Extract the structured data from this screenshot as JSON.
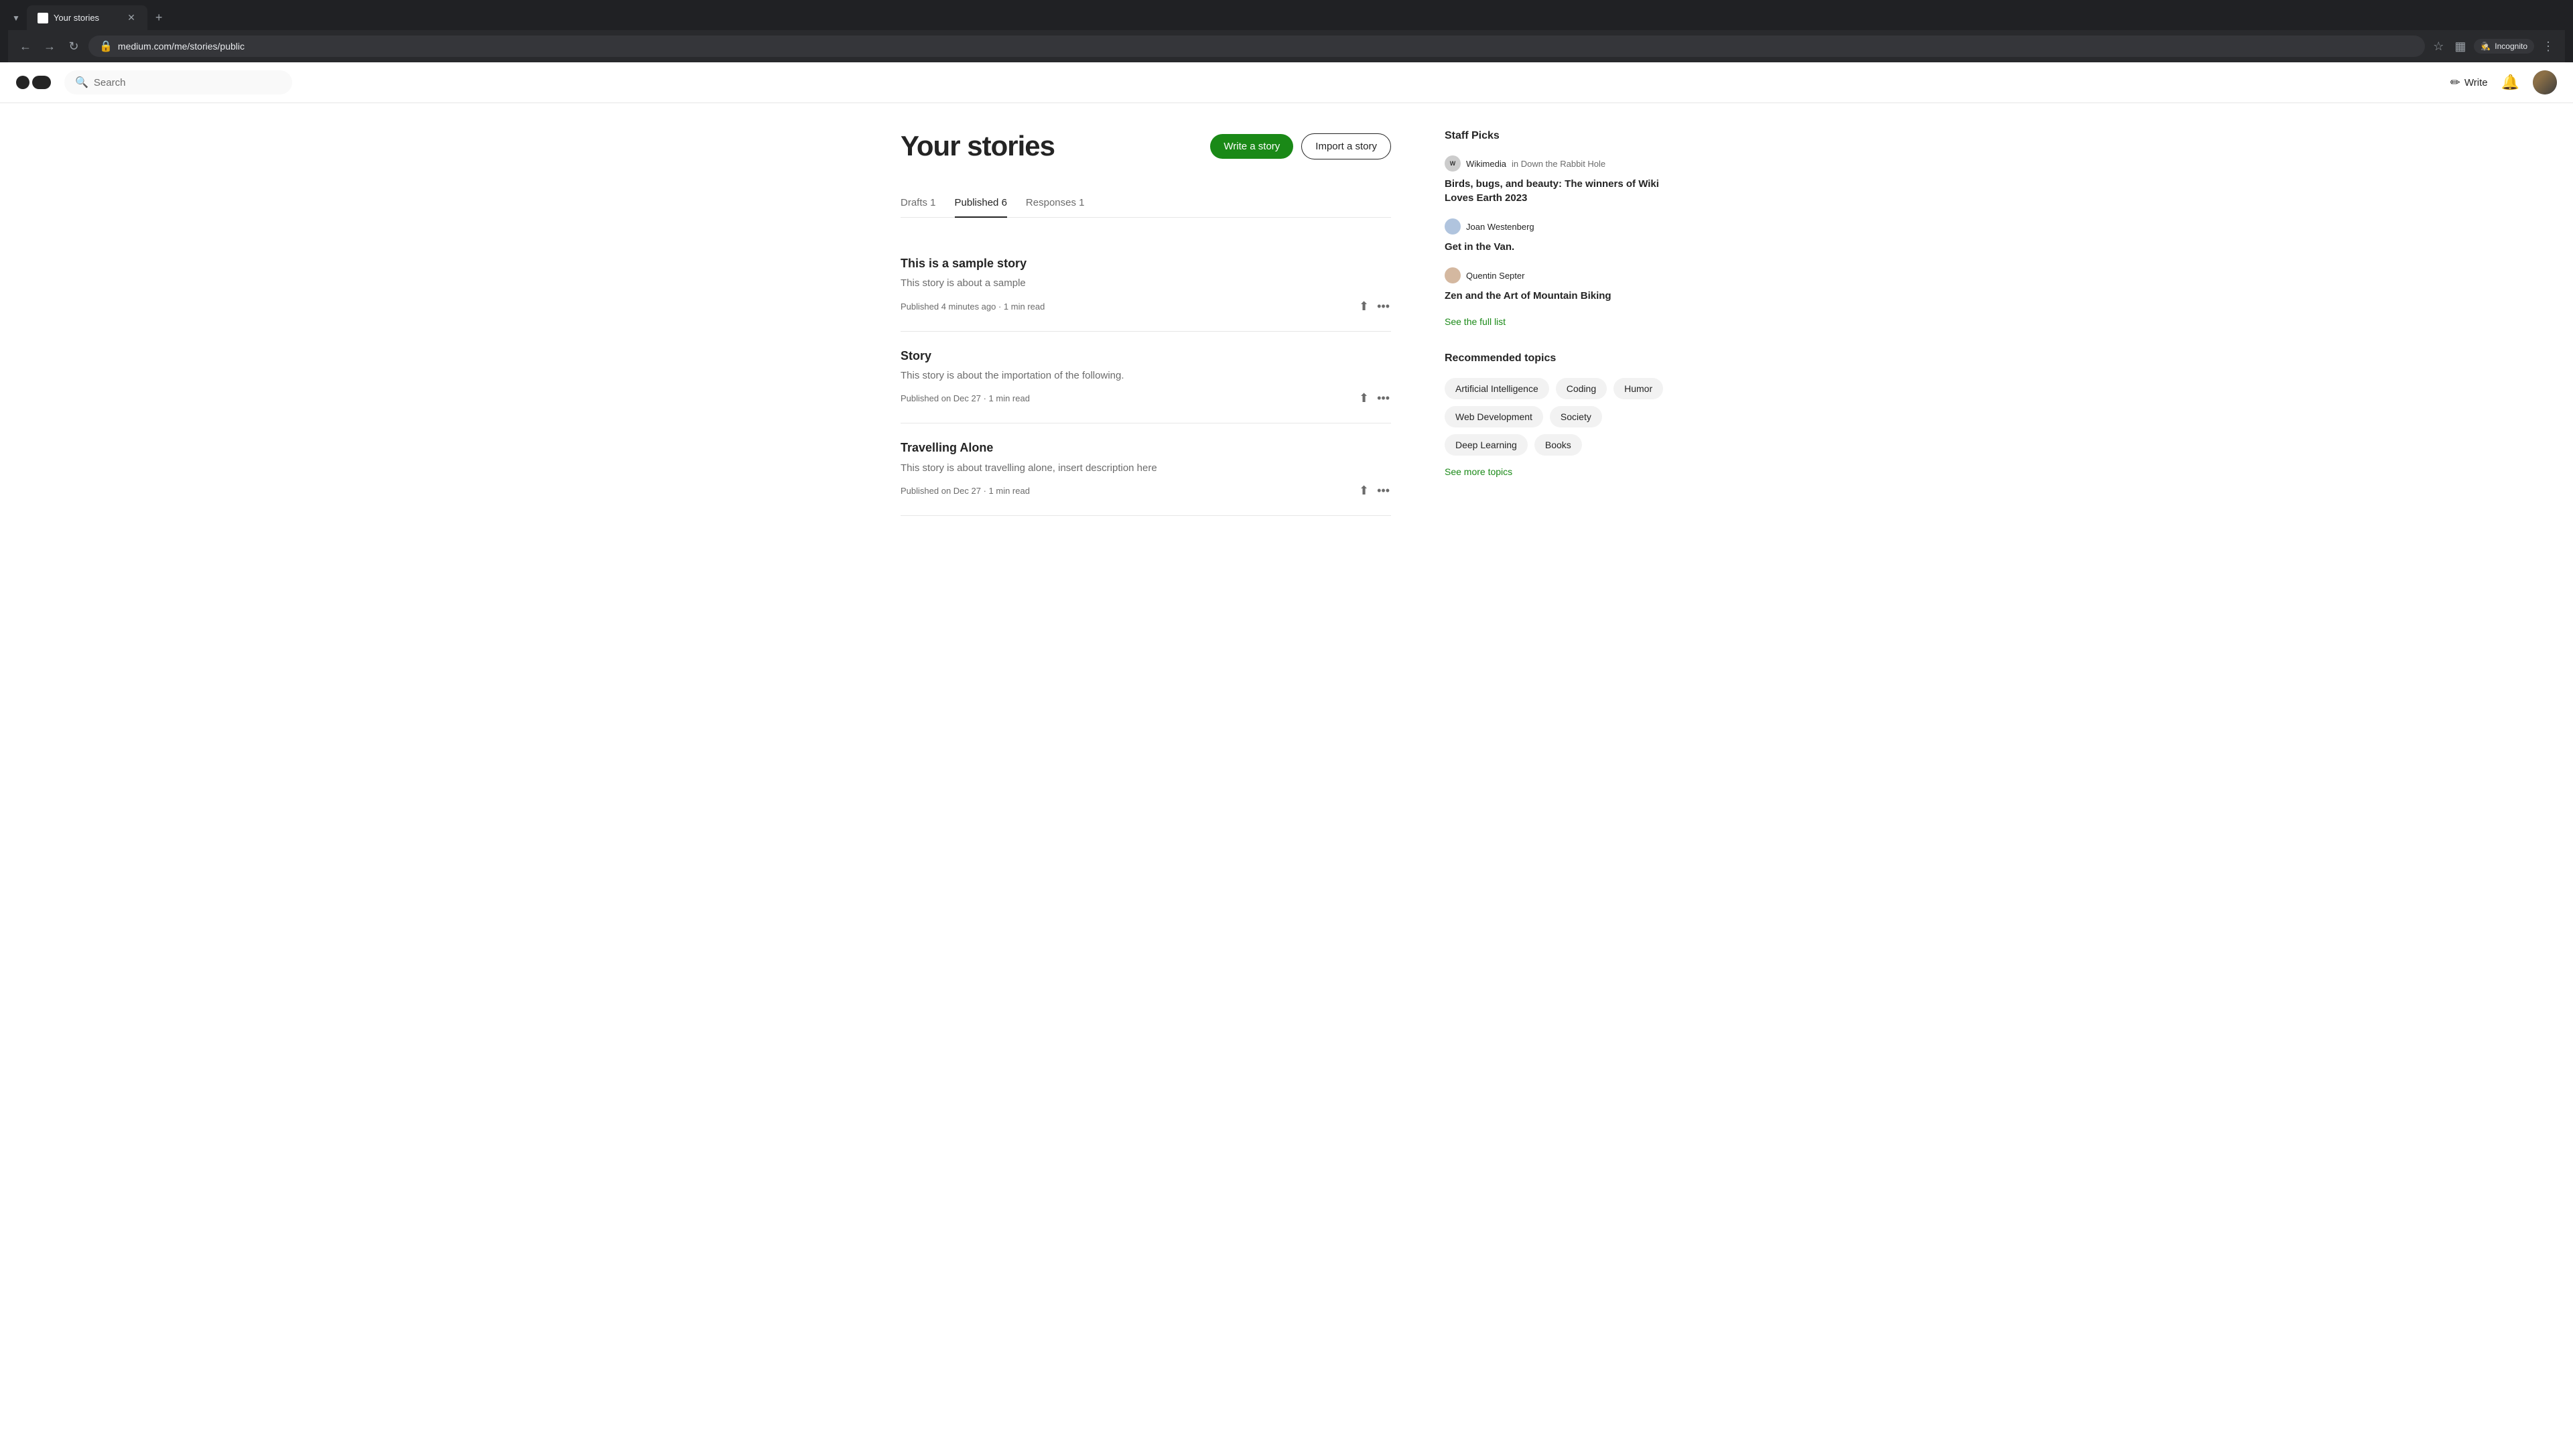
{
  "browser": {
    "tab_title": "Your stories",
    "tab_favicon": "M",
    "url": "medium.com/me/stories/public",
    "nav": {
      "back": "←",
      "forward": "→",
      "refresh": "↻"
    },
    "incognito_label": "Incognito",
    "new_tab": "+"
  },
  "header": {
    "logo_alt": "Medium",
    "search_placeholder": "Search",
    "write_label": "Write",
    "notifications_label": "Notifications"
  },
  "page": {
    "title": "Your stories",
    "actions": {
      "write_story": "Write a story",
      "import_story": "Import a story"
    },
    "tabs": [
      {
        "label": "Drafts 1",
        "active": false
      },
      {
        "label": "Published 6",
        "active": true
      },
      {
        "label": "Responses 1",
        "active": false
      }
    ],
    "stories": [
      {
        "title": "This is a sample story",
        "excerpt": "This story is about a sample",
        "meta": "Published 4 minutes ago · 1 min read"
      },
      {
        "title": "Story",
        "excerpt": "This story is about the importation of the following.",
        "meta": "Published on Dec 27 · 1 min read"
      },
      {
        "title": "Travelling Alone",
        "excerpt": "This story is about travelling alone, insert description here",
        "meta": "Published on Dec 27 · 1 min read"
      }
    ]
  },
  "sidebar": {
    "staff_picks": {
      "title": "Staff Picks",
      "items": [
        {
          "author": "Wikimedia",
          "publication": "in Down the Rabbit Hole",
          "title": "Birds, bugs, and beauty: The winners of Wiki Loves Earth 2023",
          "avatar_type": "wiki"
        },
        {
          "author": "Joan Westenberg",
          "publication": "",
          "title": "Get in the Van.",
          "avatar_type": "joan"
        },
        {
          "author": "Quentin Septer",
          "publication": "",
          "title": "Zen and the Art of Mountain Biking",
          "avatar_type": "quentin"
        }
      ],
      "see_full_list": "See the full list"
    },
    "recommended_topics": {
      "title": "Recommended topics",
      "topics": [
        "Artificial Intelligence",
        "Coding",
        "Humor",
        "Web Development",
        "Society",
        "Deep Learning",
        "Books"
      ],
      "see_more": "See more topics"
    }
  }
}
